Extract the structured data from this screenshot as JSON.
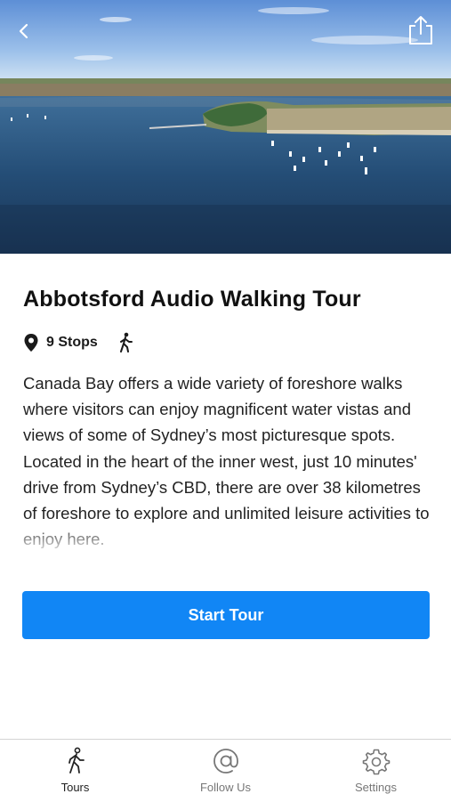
{
  "hero": {
    "back_icon": "chevron-left-icon",
    "share_icon": "share-icon"
  },
  "tour": {
    "title": "Abbotsford Audio Walking Tour",
    "stops_icon": "map-pin-icon",
    "stops_label": "9 Stops",
    "mode_icon": "walking-person-icon",
    "description": "Canada Bay offers a wide variety of foreshore walks where visitors can enjoy magnificent water vistas and views of some of Sydney’s most picturesque spots. Located in the heart of the inner west, just 10 minutes' drive from Sydney’s CBD, there are over 38 kilometres of foreshore to explore and unlimited leisure activities to enjoy here."
  },
  "actions": {
    "start_label": "Start Tour"
  },
  "tabbar": {
    "tabs": [
      {
        "label": "Tours",
        "icon": "walking-person-icon",
        "active": true
      },
      {
        "label": "Follow Us",
        "icon": "at-sign-icon",
        "active": false
      },
      {
        "label": "Settings",
        "icon": "gear-icon",
        "active": false
      }
    ]
  },
  "colors": {
    "accent": "#1186f5",
    "text": "#1a1a1a",
    "inactive_tab": "#777777"
  }
}
